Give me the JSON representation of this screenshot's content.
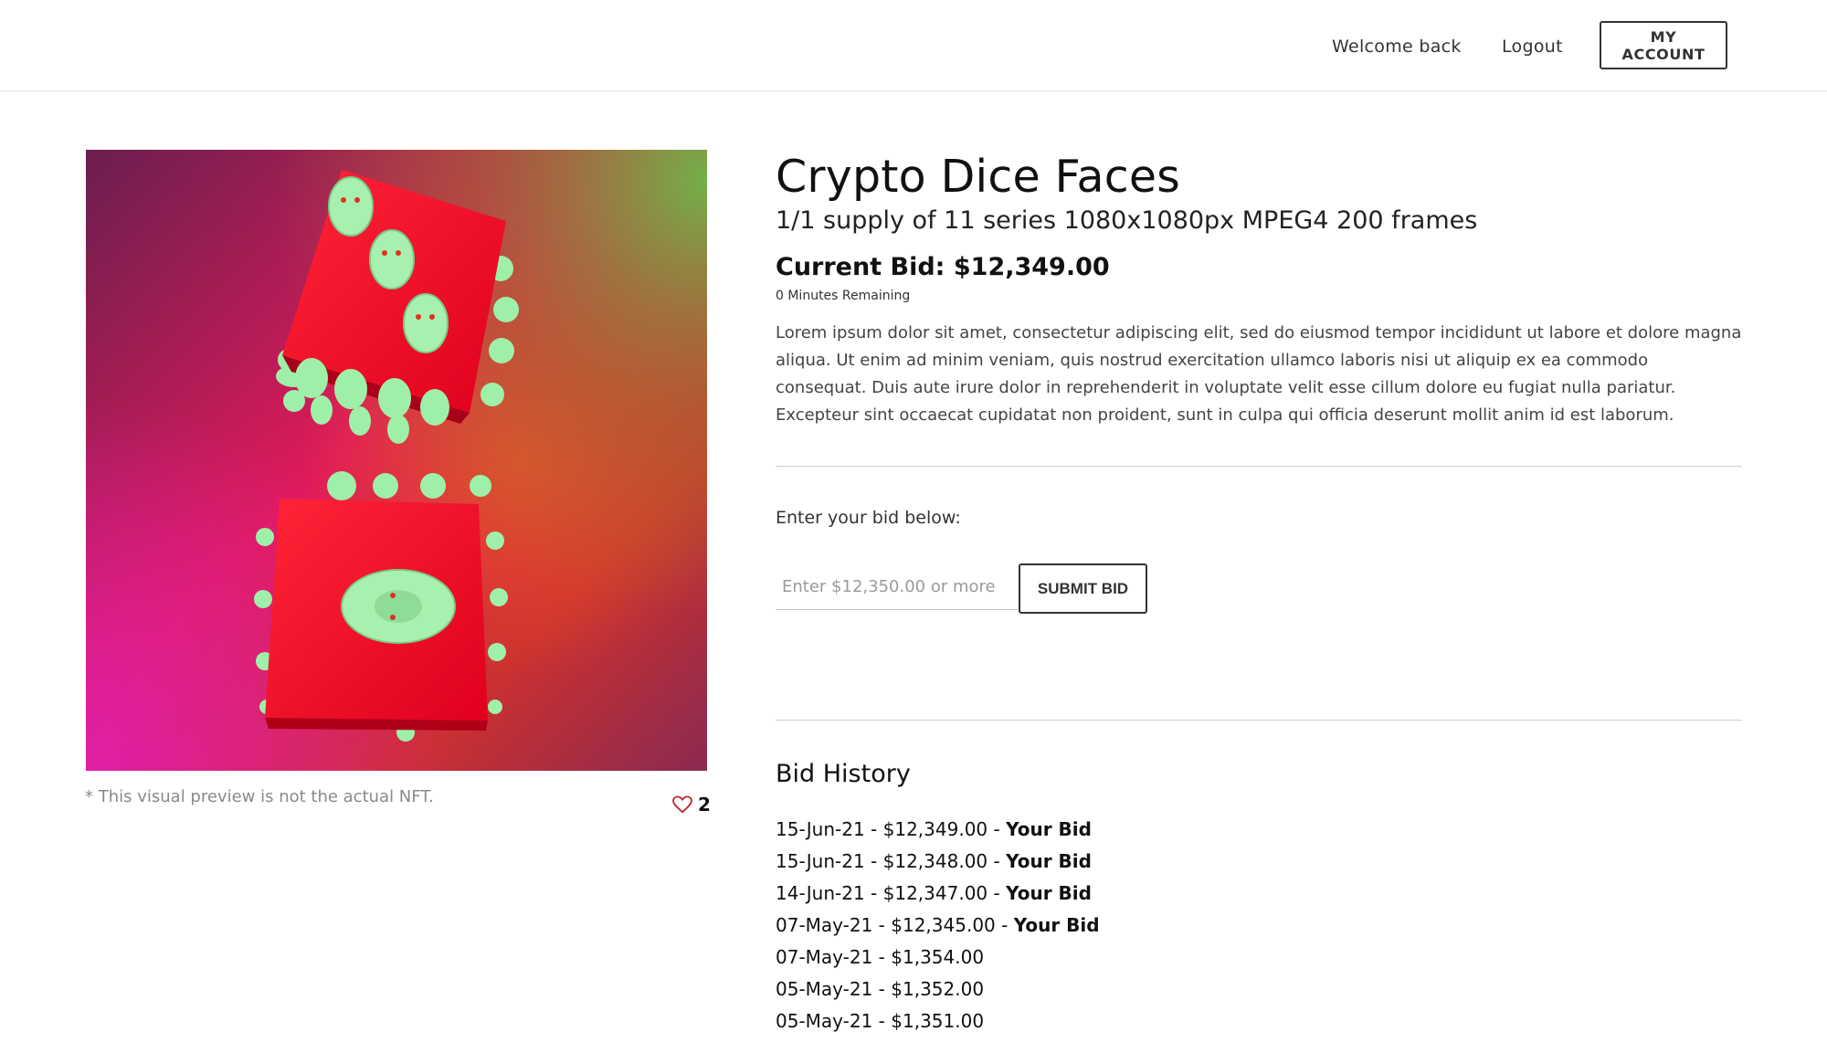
{
  "header": {
    "welcome": "Welcome back",
    "logout": "Logout",
    "account": "MY ACCOUNT"
  },
  "artwork": {
    "caption": "* This visual preview is not the actual NFT.",
    "likes": "2",
    "like_icon": "heart-icon"
  },
  "item": {
    "title": "Crypto Dice Faces",
    "subtitle": "1/1 supply of 11 series 1080x1080px MPEG4 200 frames",
    "current_bid": "Current Bid: $12,349.00",
    "remaining": "0 Minutes Remaining",
    "description": "Lorem ipsum dolor sit amet, consectetur adipiscing elit, sed do eiusmod tempor incididunt ut labore et dolore magna aliqua. Ut enim ad minim veniam, quis nostrud exercitation ullamco laboris nisi ut aliquip ex ea commodo consequat. Duis aute irure dolor in reprehenderit in voluptate velit esse cillum dolore eu fugiat nulla pariatur. Excepteur sint occaecat cupidatat non proident, sunt in culpa qui officia deserunt mollit anim id est laborum."
  },
  "bid_form": {
    "label": "Enter your bid below:",
    "placeholder": "Enter $12,350.00 or more",
    "submit": "SUBMIT BID"
  },
  "history": {
    "title": "Bid History",
    "entries": [
      {
        "text": "15-Jun-21 - $12,349.00 - ",
        "tag": "Your Bid"
      },
      {
        "text": "15-Jun-21 - $12,348.00 - ",
        "tag": "Your Bid"
      },
      {
        "text": "14-Jun-21 - $12,347.00 - ",
        "tag": "Your Bid"
      },
      {
        "text": "07-May-21 - $12,345.00 - ",
        "tag": "Your Bid"
      },
      {
        "text": "07-May-21 - $1,354.00",
        "tag": ""
      },
      {
        "text": "05-May-21 - $1,352.00",
        "tag": ""
      },
      {
        "text": "05-May-21 - $1,351.00",
        "tag": ""
      }
    ]
  },
  "colors": {
    "dice": "#ff1a2a",
    "faces": "#9ef0a8",
    "text": "#111111"
  }
}
